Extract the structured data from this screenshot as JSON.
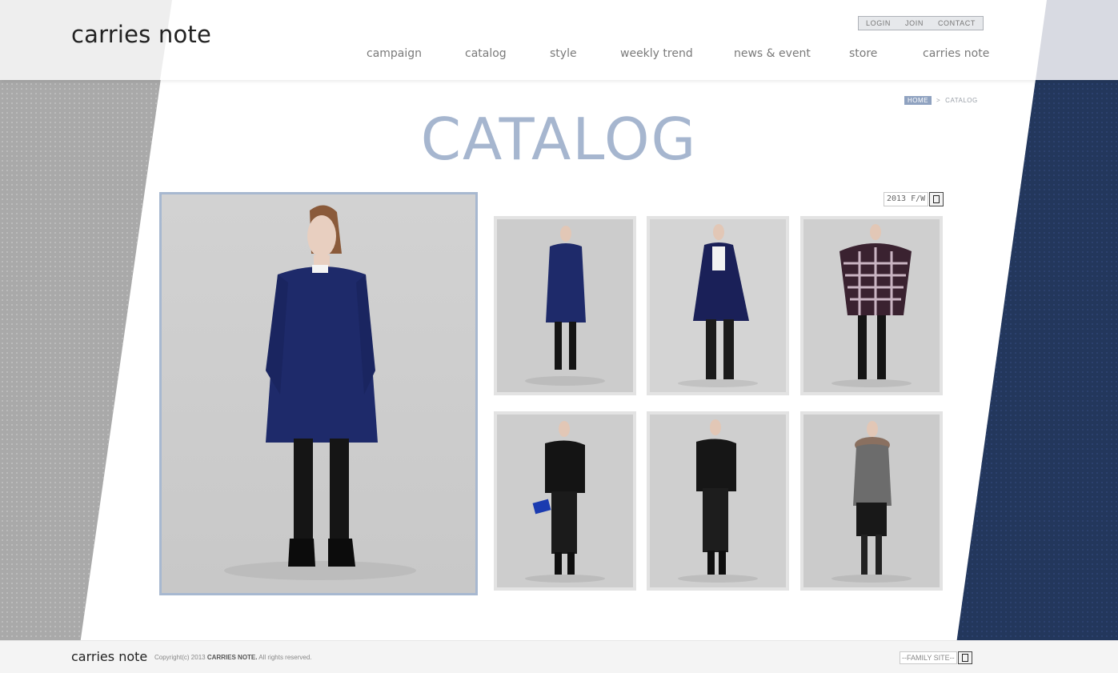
{
  "brand": {
    "logo": "carries note"
  },
  "util_links": [
    "LOGIN",
    "JOIN",
    "CONTACT"
  ],
  "nav": [
    "campaign",
    "catalog",
    "style",
    "weekly trend",
    "news & event",
    "store",
    "carries note"
  ],
  "breadcrumb": {
    "home": "HOME",
    "separator": ">",
    "current": "CATALOG"
  },
  "page_title": "CATALOG",
  "season_select": {
    "value": "2013 F/W"
  },
  "gallery": {
    "main": {
      "outfit": "navy-coat"
    },
    "thumbs": [
      {
        "outfit": "navy-coat"
      },
      {
        "outfit": "black-blazer"
      },
      {
        "outfit": "plaid-cape"
      },
      {
        "outfit": "black-top-clutch"
      },
      {
        "outfit": "black-top-side"
      },
      {
        "outfit": "fur-collar-coat"
      }
    ]
  },
  "footer": {
    "logo": "carries note",
    "copyright_prefix": "Copyright(c) 2013 ",
    "copyright_brand": "CARRIES NOTE.",
    "copyright_suffix": " All rights reserved.",
    "family_site": "--FAMILY SITE--"
  },
  "colors": {
    "accent": "#a6b6cf",
    "navy_panel": "#23375c",
    "grey_panel": "#a9a9a9",
    "photo_border": "#a7b8d0"
  }
}
